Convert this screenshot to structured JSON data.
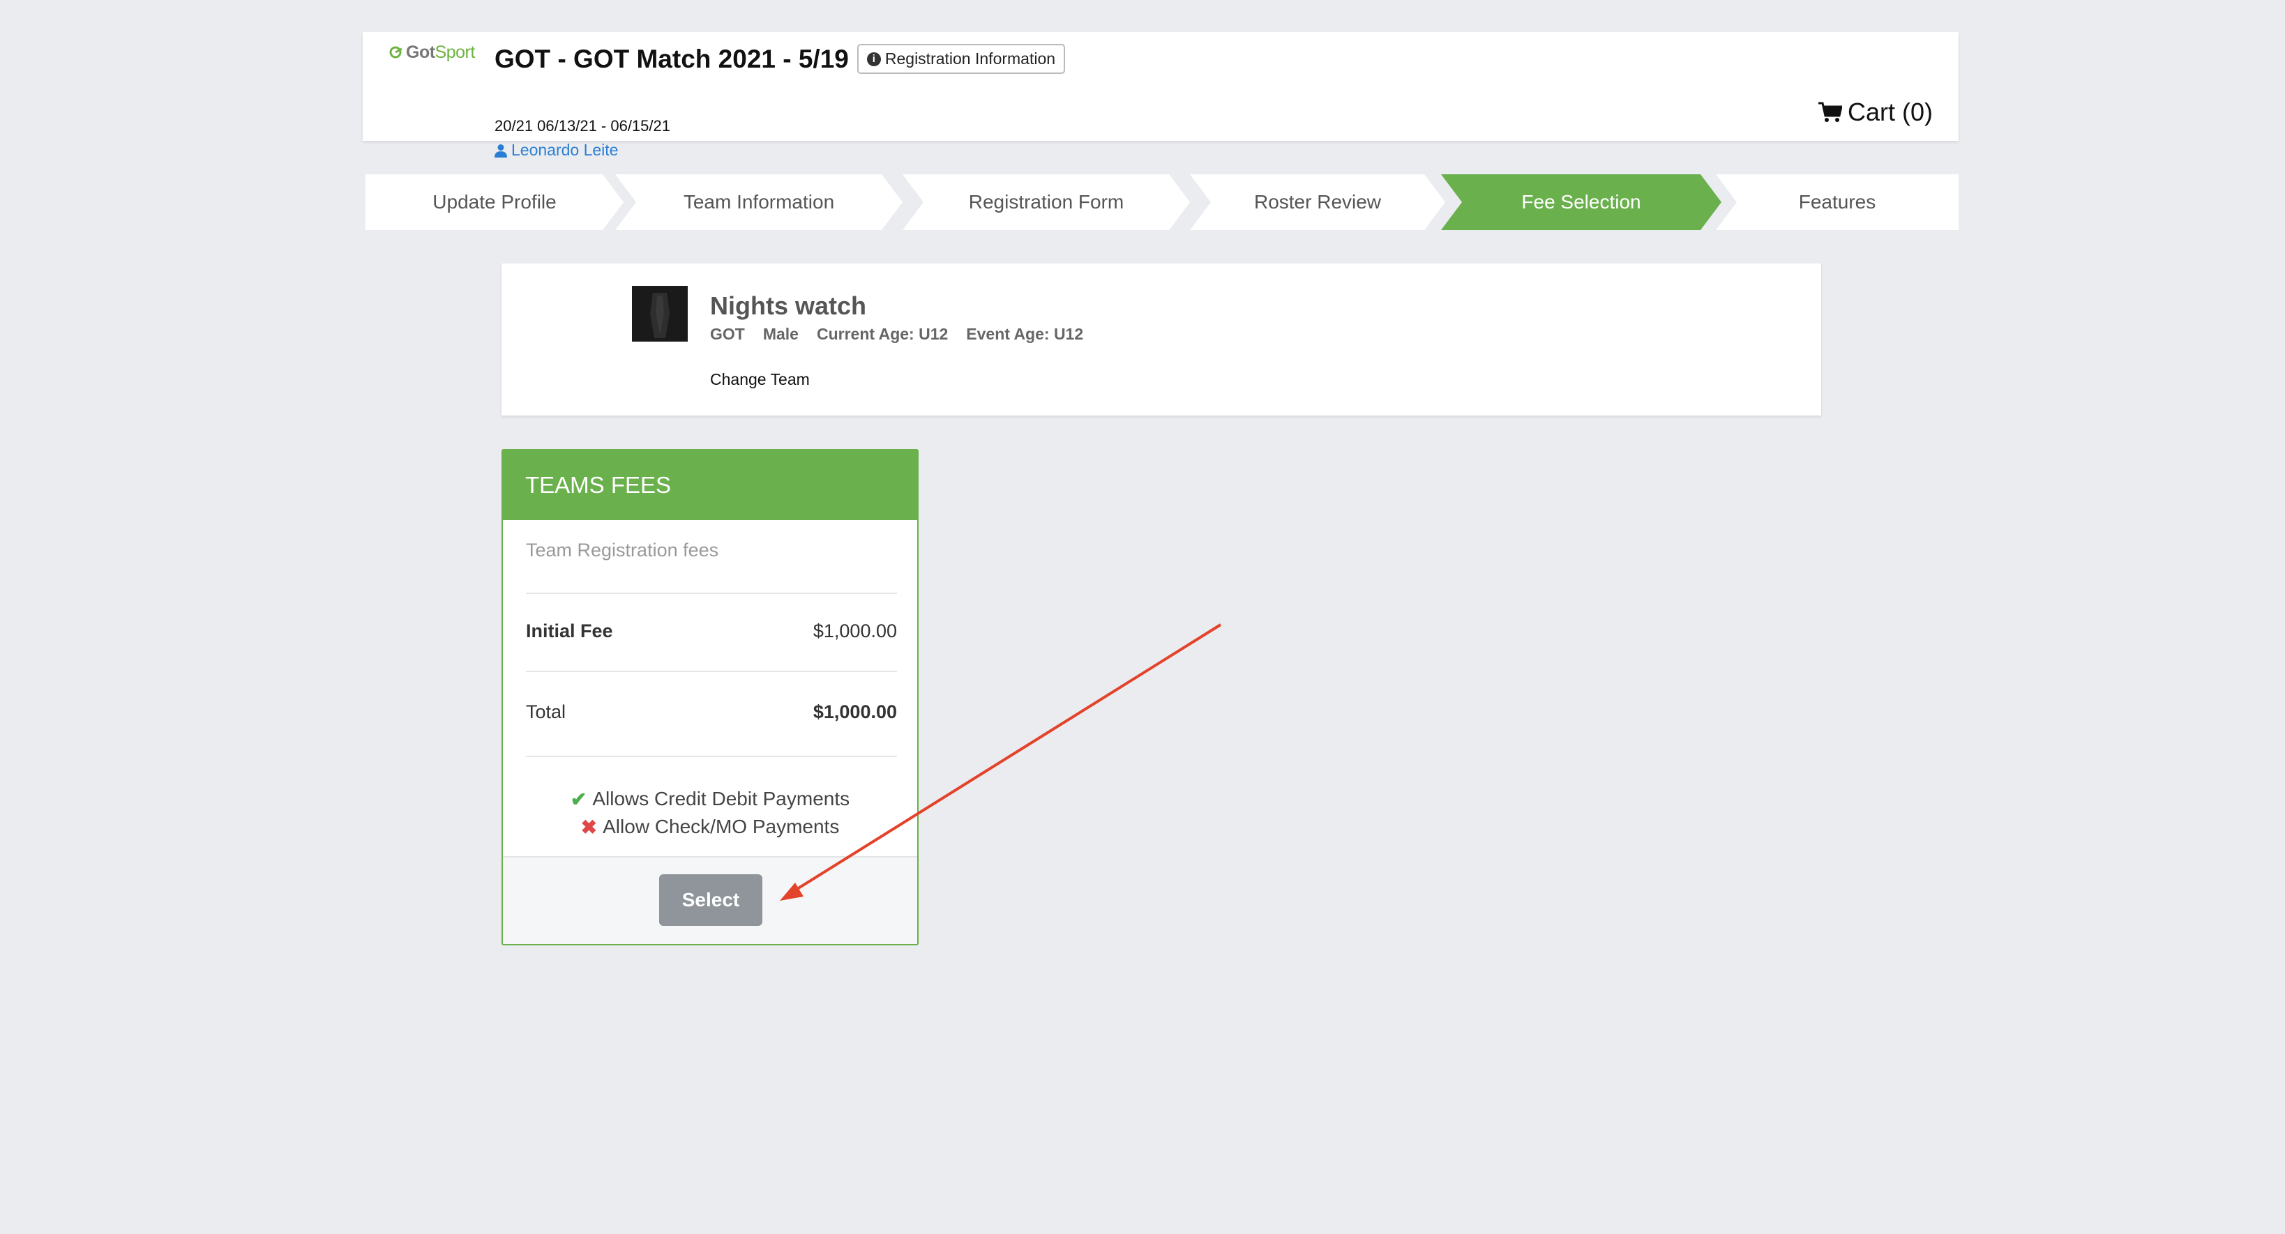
{
  "header": {
    "logo_prefix": "Got",
    "logo_suffix": "Sport",
    "event_title": "GOT - GOT Match 2021 - 5/19",
    "reg_info_label": "Registration Information",
    "dates": "20/21 06/13/21 - 06/15/21",
    "user_name": "Leonardo Leite",
    "cart_label": "Cart (0)"
  },
  "steps": {
    "items": [
      {
        "label": "Update Profile",
        "active": false
      },
      {
        "label": "Team Information",
        "active": false
      },
      {
        "label": "Registration Form",
        "active": false
      },
      {
        "label": "Roster Review",
        "active": false
      },
      {
        "label": "Fee Selection",
        "active": true
      },
      {
        "label": "Features",
        "active": false
      }
    ]
  },
  "team": {
    "name": "Nights watch",
    "club": "GOT",
    "gender": "Male",
    "current_age": "Current Age: U12",
    "event_age": "Event Age: U12",
    "change_label": "Change Team"
  },
  "fees": {
    "header": "TEAMS FEES",
    "subtitle": "Team Registration fees",
    "initial_label": "Initial Fee",
    "initial_value": "$1,000.00",
    "total_label": "Total",
    "total_value": "$1,000.00",
    "credit_label": "Allows Credit Debit Payments",
    "check_label": "Allow Check/MO Payments",
    "select_label": "Select"
  },
  "colors": {
    "accent_green": "#6ab04c",
    "link_blue": "#2a7fd4",
    "annotation_red": "#e2432a",
    "page_bg": "#ebecf0"
  }
}
